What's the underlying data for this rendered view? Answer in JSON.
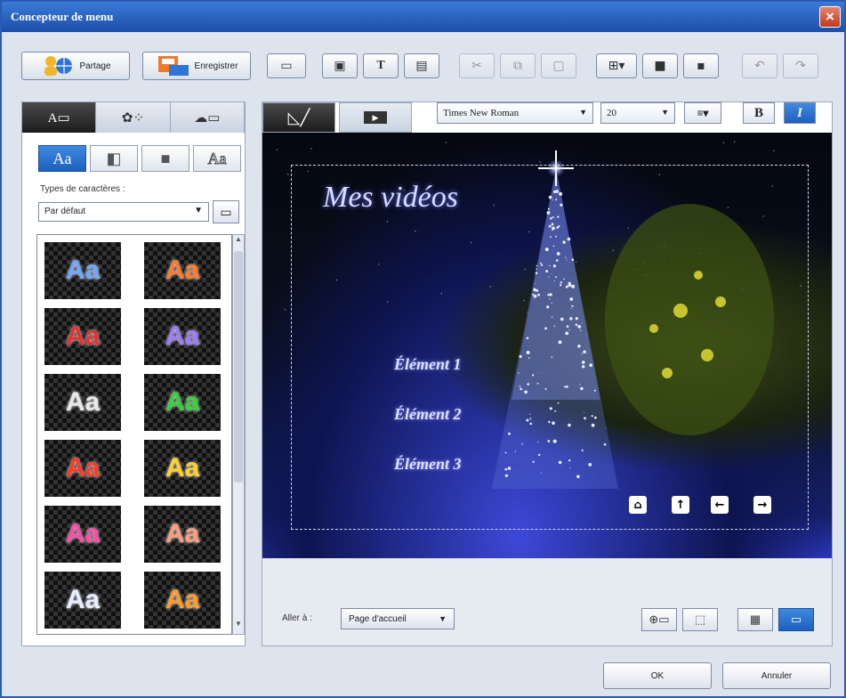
{
  "window": {
    "title": "Concepteur de menu",
    "close_icon": "close-icon"
  },
  "toolbar": {
    "share_label": "Partage",
    "save_label": "Enregistrer",
    "icons": [
      "share-icon",
      "save-icon",
      "properties-icon",
      "add-image-icon",
      "add-text-icon",
      "add-video-icon",
      "cut-icon",
      "copy-icon",
      "paste-icon",
      "layout-icon",
      "bring-front-icon",
      "send-back-icon",
      "undo-icon",
      "redo-icon"
    ]
  },
  "left_panel": {
    "tabs": [
      "text-tab",
      "effects-tab",
      "frames-tab"
    ],
    "styles": [
      "Aa",
      "",
      "",
      "Aa"
    ],
    "types_label": "Types de caractères :",
    "types_value": "Par défaut",
    "thumbnails": [
      {
        "text": "Aa",
        "color": "#6fa6ff"
      },
      {
        "text": "Aa",
        "color": "#ff7b2a"
      },
      {
        "text": "Aa",
        "color": "#e83030"
      },
      {
        "text": "Aa",
        "color": "#9b7bff"
      },
      {
        "text": "Aa",
        "color": "#e8e8e8"
      },
      {
        "text": "Aa",
        "color": "#32d23a"
      },
      {
        "text": "Aa",
        "color": "#ff3a20"
      },
      {
        "text": "Aa",
        "color": "#ffd02a"
      },
      {
        "text": "Aa",
        "color": "#ff4aa8"
      },
      {
        "text": "Aa",
        "color": "#ff9a7a"
      },
      {
        "text": "Aa",
        "color": "#e8ecff"
      },
      {
        "text": "Aa",
        "color": "#ff9a2a"
      }
    ]
  },
  "right_panel": {
    "font_name": "Times New Roman",
    "font_size": "20",
    "bold_label": "B",
    "italic_label": "I",
    "menu": {
      "title": "Mes vidéos",
      "items": [
        "Élément 1",
        "Élément 2",
        "Élément 3"
      ]
    },
    "goto_label": "Aller à :",
    "goto_value": "Page d'accueil"
  },
  "footer": {
    "ok_label": "OK",
    "cancel_label": "Annuler"
  }
}
